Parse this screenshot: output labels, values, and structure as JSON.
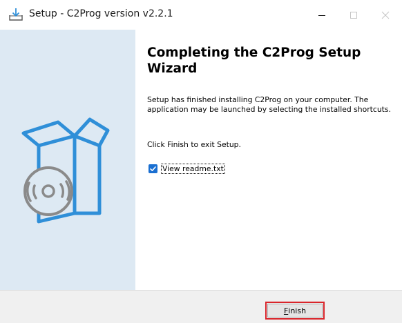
{
  "window": {
    "title": "Setup - C2Prog version v2.2.1",
    "title_icon": "installer-download-icon",
    "controls": {
      "minimize_icon": "minimize-icon",
      "maximize_icon": "maximize-icon",
      "close_icon": "close-icon"
    }
  },
  "banner": {
    "art": "software-box-disc-icon",
    "background_color": "#dde9f3",
    "accent_color": "#2f8fd8"
  },
  "content": {
    "heading": "Completing the C2Prog Setup Wizard",
    "paragraph": "Setup has finished installing C2Prog on your computer. The application may be launched by selecting the installed shortcuts.",
    "exit_hint": "Click Finish to exit Setup.",
    "checkbox": {
      "label": "View readme.txt",
      "checked": true,
      "check_color": "#1a6fd1"
    }
  },
  "footer": {
    "finish_button": {
      "accel": "F",
      "label_rest": "inish",
      "highlight_color": "#d9252b"
    }
  }
}
